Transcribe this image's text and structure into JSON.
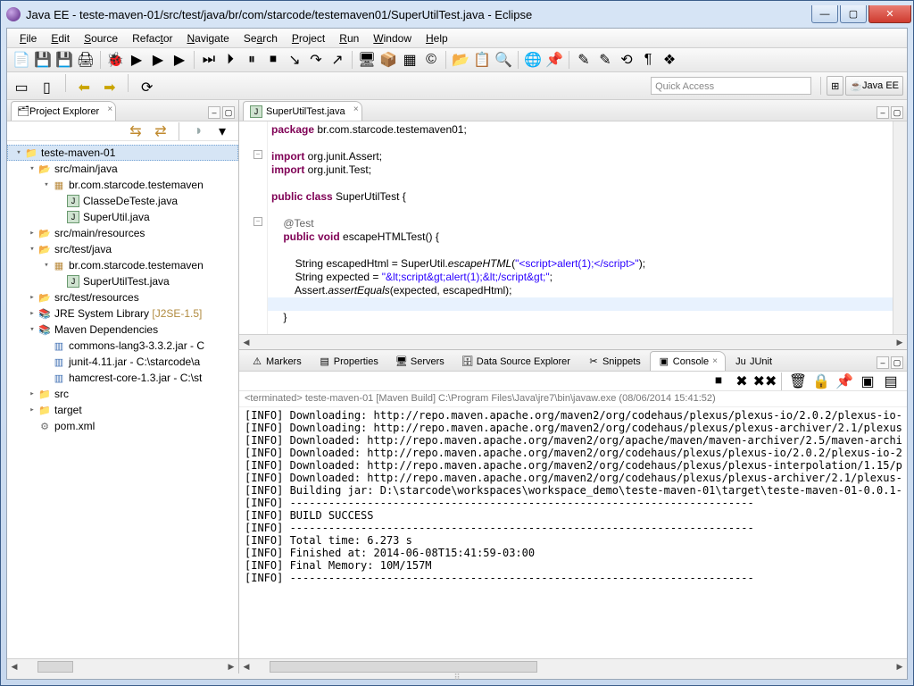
{
  "window": {
    "title": "Java EE - teste-maven-01/src/test/java/br/com/starcode/testemaven01/SuperUtilTest.java - Eclipse"
  },
  "menu": [
    "File",
    "Edit",
    "Source",
    "Refactor",
    "Navigate",
    "Search",
    "Project",
    "Run",
    "Window",
    "Help"
  ],
  "quick_access_placeholder": "Quick Access",
  "perspective": {
    "label": "Java EE"
  },
  "explorer": {
    "title": "Project Explorer",
    "nodes": [
      {
        "d": 0,
        "exp": "open",
        "icon": "prj",
        "label": "teste-maven-01",
        "sel": true
      },
      {
        "d": 1,
        "exp": "open",
        "icon": "fld",
        "label": "src/main/java"
      },
      {
        "d": 2,
        "exp": "open",
        "icon": "pkg",
        "label": "br.com.starcode.testemaven"
      },
      {
        "d": 3,
        "exp": "leaf",
        "icon": "java",
        "label": "ClasseDeTeste.java"
      },
      {
        "d": 3,
        "exp": "leaf",
        "icon": "java",
        "label": "SuperUtil.java"
      },
      {
        "d": 1,
        "exp": "closed",
        "icon": "fld",
        "label": "src/main/resources"
      },
      {
        "d": 1,
        "exp": "open",
        "icon": "fld",
        "label": "src/test/java"
      },
      {
        "d": 2,
        "exp": "open",
        "icon": "pkg",
        "label": "br.com.starcode.testemaven"
      },
      {
        "d": 3,
        "exp": "leaf",
        "icon": "java",
        "label": "SuperUtilTest.java"
      },
      {
        "d": 1,
        "exp": "closed",
        "icon": "fld",
        "label": "src/test/resources"
      },
      {
        "d": 1,
        "exp": "closed",
        "icon": "lib",
        "label": "JRE System Library [J2SE-1.5]"
      },
      {
        "d": 1,
        "exp": "open",
        "icon": "lib",
        "label": "Maven Dependencies"
      },
      {
        "d": 2,
        "exp": "leaf",
        "icon": "jar",
        "label": "commons-lang3-3.3.2.jar - C"
      },
      {
        "d": 2,
        "exp": "leaf",
        "icon": "jar",
        "label": "junit-4.11.jar - C:\\starcode\\a"
      },
      {
        "d": 2,
        "exp": "leaf",
        "icon": "jar",
        "label": "hamcrest-core-1.3.jar - C:\\st"
      },
      {
        "d": 1,
        "exp": "closed",
        "icon": "fldc",
        "label": "src"
      },
      {
        "d": 1,
        "exp": "closed",
        "icon": "fldc",
        "label": "target"
      },
      {
        "d": 1,
        "exp": "leaf",
        "icon": "xml",
        "label": "pom.xml"
      }
    ]
  },
  "editor": {
    "tab": "SuperUtilTest.java",
    "lines": [
      {
        "t": "package ",
        "rest": "br.com.starcode.testemaven01;",
        "kw": true
      },
      {
        "blank": true
      },
      {
        "t": "import ",
        "rest": "org.junit.Assert;",
        "kw": true,
        "fold": true
      },
      {
        "t": "import ",
        "rest": "org.junit.Test;",
        "kw": true
      },
      {
        "blank": true
      },
      {
        "raw": "<span class='kw'>public class</span> SuperUtilTest {"
      },
      {
        "blank": true
      },
      {
        "raw": "    <span class='ann'>@Test</span>",
        "fold": true
      },
      {
        "raw": "    <span class='kw'>public void</span> escapeHTMLTest() {"
      },
      {
        "blank": true
      },
      {
        "raw": "        String escapedHtml = SuperUtil.<span class='it'>escapeHTML</span>(<span class='str'>\"&lt;script&gt;alert(1);&lt;/script&gt;\"</span>);"
      },
      {
        "raw": "        String expected = <span class='str'>\"&amp;lt;script&amp;gt;alert(1);&amp;lt;/script&amp;gt;\"</span>;"
      },
      {
        "raw": "        Assert.<span class='it'>assertEquals</span>(expected, escapedHtml);"
      },
      {
        "blank": true,
        "hilite": true
      },
      {
        "raw": "    }"
      }
    ]
  },
  "bottom_tabs": [
    {
      "label": "Markers",
      "icon": "⚠"
    },
    {
      "label": "Properties",
      "icon": "▤"
    },
    {
      "label": "Servers",
      "icon": "🖥"
    },
    {
      "label": "Data Source Explorer",
      "icon": "🗄"
    },
    {
      "label": "Snippets",
      "icon": "✂"
    },
    {
      "label": "Console",
      "icon": "▣",
      "active": true
    },
    {
      "label": "JUnit",
      "icon": "Ju"
    }
  ],
  "console": {
    "status": "<terminated> teste-maven-01 [Maven Build] C:\\Program Files\\Java\\jre7\\bin\\javaw.exe (08/06/2014 15:41:52)",
    "lines": [
      "[INFO] Downloading: http://repo.maven.apache.org/maven2/org/codehaus/plexus/plexus-io/2.0.2/plexus-io-",
      "[INFO] Downloading: http://repo.maven.apache.org/maven2/org/codehaus/plexus/plexus-archiver/2.1/plexus",
      "[INFO] Downloaded: http://repo.maven.apache.org/maven2/org/apache/maven/maven-archiver/2.5/maven-archi",
      "[INFO] Downloaded: http://repo.maven.apache.org/maven2/org/codehaus/plexus/plexus-io/2.0.2/plexus-io-2",
      "[INFO] Downloaded: http://repo.maven.apache.org/maven2/org/codehaus/plexus/plexus-interpolation/1.15/p",
      "[INFO] Downloaded: http://repo.maven.apache.org/maven2/org/codehaus/plexus/plexus-archiver/2.1/plexus-",
      "[INFO] Building jar: D:\\starcode\\workspaces\\workspace_demo\\teste-maven-01\\target\\teste-maven-01-0.0.1-",
      "[INFO] ------------------------------------------------------------------------",
      "[INFO] BUILD SUCCESS",
      "[INFO] ------------------------------------------------------------------------",
      "[INFO] Total time: 6.273 s",
      "[INFO] Finished at: 2014-06-08T15:41:59-03:00",
      "[INFO] Final Memory: 10M/157M",
      "[INFO] ------------------------------------------------------------------------"
    ]
  }
}
